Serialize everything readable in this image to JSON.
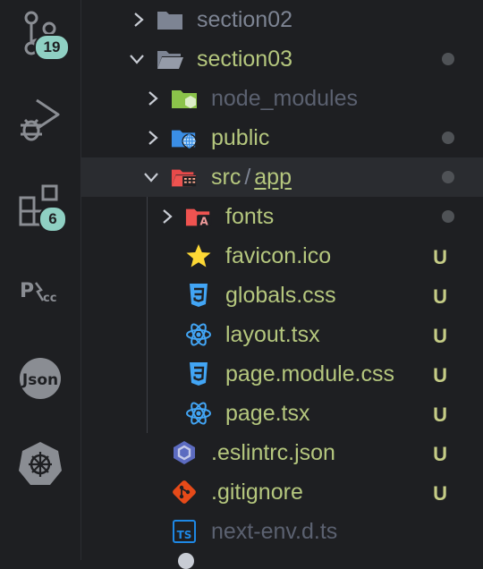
{
  "activity_bar": {
    "items": [
      {
        "icon": "source-control-icon",
        "badge": "19"
      },
      {
        "icon": "run-debug-icon"
      },
      {
        "icon": "extensions-icon",
        "badge": "6"
      },
      {
        "icon": "postcss-icon"
      },
      {
        "icon": "json-icon",
        "label": "Json"
      },
      {
        "icon": "kubernetes-icon"
      }
    ]
  },
  "explorer": {
    "rows": [
      {
        "name": "section02",
        "type": "folder",
        "expanded": false,
        "icon": "folder-icon"
      },
      {
        "name": "section03",
        "type": "folder",
        "expanded": true,
        "icon": "folder-open-icon",
        "modified": true
      },
      {
        "name": "node_modules",
        "type": "folder",
        "expanded": false,
        "icon": "node-folder-icon"
      },
      {
        "name": "public",
        "type": "folder",
        "expanded": false,
        "icon": "public-folder-icon",
        "modified": true
      },
      {
        "name_part1": "src",
        "name_sep": "/",
        "name_part2": "app",
        "type": "folder",
        "expanded": true,
        "icon": "src-folder-icon",
        "modified": true,
        "selected": true
      },
      {
        "name": "fonts",
        "type": "folder",
        "expanded": false,
        "icon": "font-folder-icon",
        "modified": true
      },
      {
        "name": "favicon.ico",
        "type": "file",
        "icon": "star-icon",
        "status": "U"
      },
      {
        "name": "globals.css",
        "type": "file",
        "icon": "css-icon",
        "status": "U"
      },
      {
        "name": "layout.tsx",
        "type": "file",
        "icon": "react-icon",
        "status": "U"
      },
      {
        "name": "page.module.css",
        "type": "file",
        "icon": "css-icon",
        "status": "U"
      },
      {
        "name": "page.tsx",
        "type": "file",
        "icon": "react-icon",
        "status": "U"
      },
      {
        "name": ".eslintrc.json",
        "type": "file",
        "icon": "eslint-icon",
        "status": "U"
      },
      {
        "name": ".gitignore",
        "type": "file",
        "icon": "git-icon",
        "status": "U"
      },
      {
        "name": "next-env.d.ts",
        "type": "file",
        "icon": "typescript-icon"
      }
    ]
  },
  "colors": {
    "background": "#1e1f22",
    "file_name": "#b5c77e",
    "badge": "#8fd0c3",
    "untracked": "#c5cc86"
  }
}
